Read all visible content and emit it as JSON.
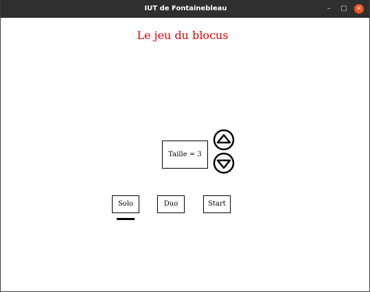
{
  "window": {
    "title": "IUT de Fontainebleau",
    "minimize_glyph": "–",
    "maximize_glyph": "□",
    "close_glyph": "✕"
  },
  "game": {
    "title": "Le jeu du blocus",
    "size_label": "Taille = 3",
    "size_up_icon": "triangle-up-circle",
    "size_down_icon": "triangle-down-circle"
  },
  "modes": {
    "solo_label": "Solo",
    "duo_label": "Duo",
    "start_label": "Start",
    "selected": "Solo"
  },
  "colors": {
    "title_text": "#e00000",
    "titlebar_bg": "#2f2f2f",
    "close_button": "#e95420"
  }
}
